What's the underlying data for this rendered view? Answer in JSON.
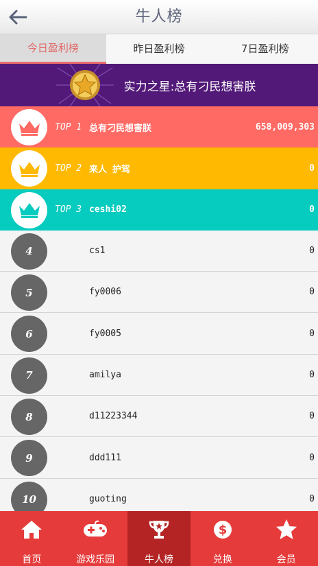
{
  "header": {
    "title": "牛人榜"
  },
  "tabs": [
    {
      "label": "今日盈利榜"
    },
    {
      "label": "昨日盈利榜"
    },
    {
      "label": "7日盈利榜"
    }
  ],
  "banner": {
    "text": "实力之星:总有刁民想害朕"
  },
  "rankings": [
    {
      "rank": "TOP 1",
      "name": "总有刁民想害朕",
      "value": "658,009,303"
    },
    {
      "rank": "TOP 2",
      "name": "来人 护驾",
      "value": "0"
    },
    {
      "rank": "TOP 3",
      "name": "ceshi02",
      "value": "0"
    },
    {
      "rank": "4",
      "name": "cs1",
      "value": "0"
    },
    {
      "rank": "5",
      "name": "fy0006",
      "value": "0"
    },
    {
      "rank": "6",
      "name": "fy0005",
      "value": "0"
    },
    {
      "rank": "7",
      "name": "amilya",
      "value": "0"
    },
    {
      "rank": "8",
      "name": "d11223344",
      "value": "0"
    },
    {
      "rank": "9",
      "name": "ddd111",
      "value": "0"
    },
    {
      "rank": "10",
      "name": "guoting",
      "value": "0"
    }
  ],
  "colors": {
    "top1": "#ff6a64",
    "top2": "#ffb900",
    "top3": "#06cbbf",
    "banner": "#521978",
    "footer": "#e53b3b"
  },
  "footer": {
    "items": [
      {
        "label": "首页",
        "icon": "home-icon"
      },
      {
        "label": "游戏乐园",
        "icon": "gamepad-icon"
      },
      {
        "label": "牛人榜",
        "icon": "trophy-icon"
      },
      {
        "label": "兑换",
        "icon": "dollar-icon"
      },
      {
        "label": "会员",
        "icon": "vip-star-icon"
      }
    ]
  }
}
